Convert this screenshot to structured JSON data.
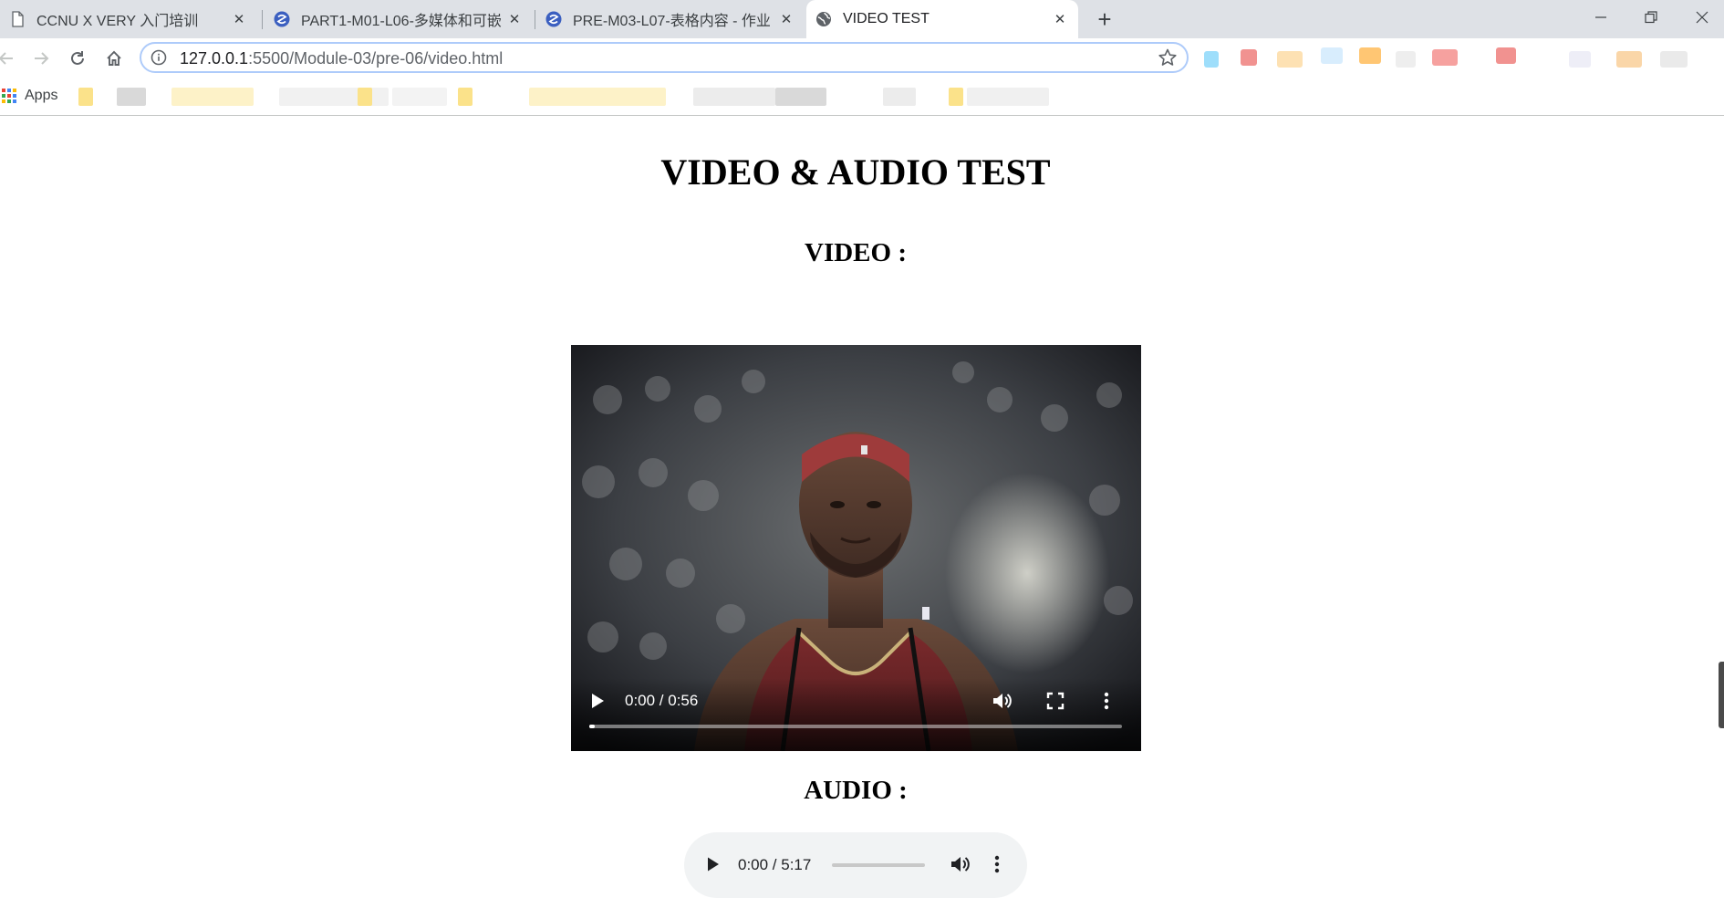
{
  "browser": {
    "tabs": [
      {
        "title": "CCNU X VERY 入门培训",
        "icon": "page-icon",
        "active": false
      },
      {
        "title": "PART1-M01-L06-多媒体和可嵌",
        "icon": "site-icon",
        "active": false
      },
      {
        "title": "PRE-M03-L07-表格内容 - 作业",
        "icon": "site-icon",
        "active": false
      },
      {
        "title": "VIDEO TEST",
        "icon": "globe-icon",
        "active": true
      }
    ],
    "new_tab_symbol": "+",
    "close_symbol": "✕",
    "window_buttons": [
      "minimize-icon",
      "restore-icon",
      "close-icon"
    ],
    "address": {
      "host": "127.0.0.1",
      "path": ":5500/Module-03/pre-06/video.html"
    },
    "bookmarks": {
      "apps_label": "Apps"
    }
  },
  "page": {
    "title": "VIDEO & AUDIO TEST",
    "video_heading": "VIDEO :",
    "audio_heading": "AUDIO :"
  },
  "video_player": {
    "time": "0:00 / 0:56",
    "progress": 0.0
  },
  "audio_player": {
    "time": "0:00 / 5:17",
    "progress": 0.0
  },
  "colors": {
    "tabstrip": "#dee1e6",
    "omnibox_focus": "#aecbfa",
    "audio_bg": "#f1f3f4",
    "google_blue": "#4285f4",
    "google_red": "#ea4335",
    "google_yellow": "#fbbc05",
    "google_green": "#34a853"
  }
}
